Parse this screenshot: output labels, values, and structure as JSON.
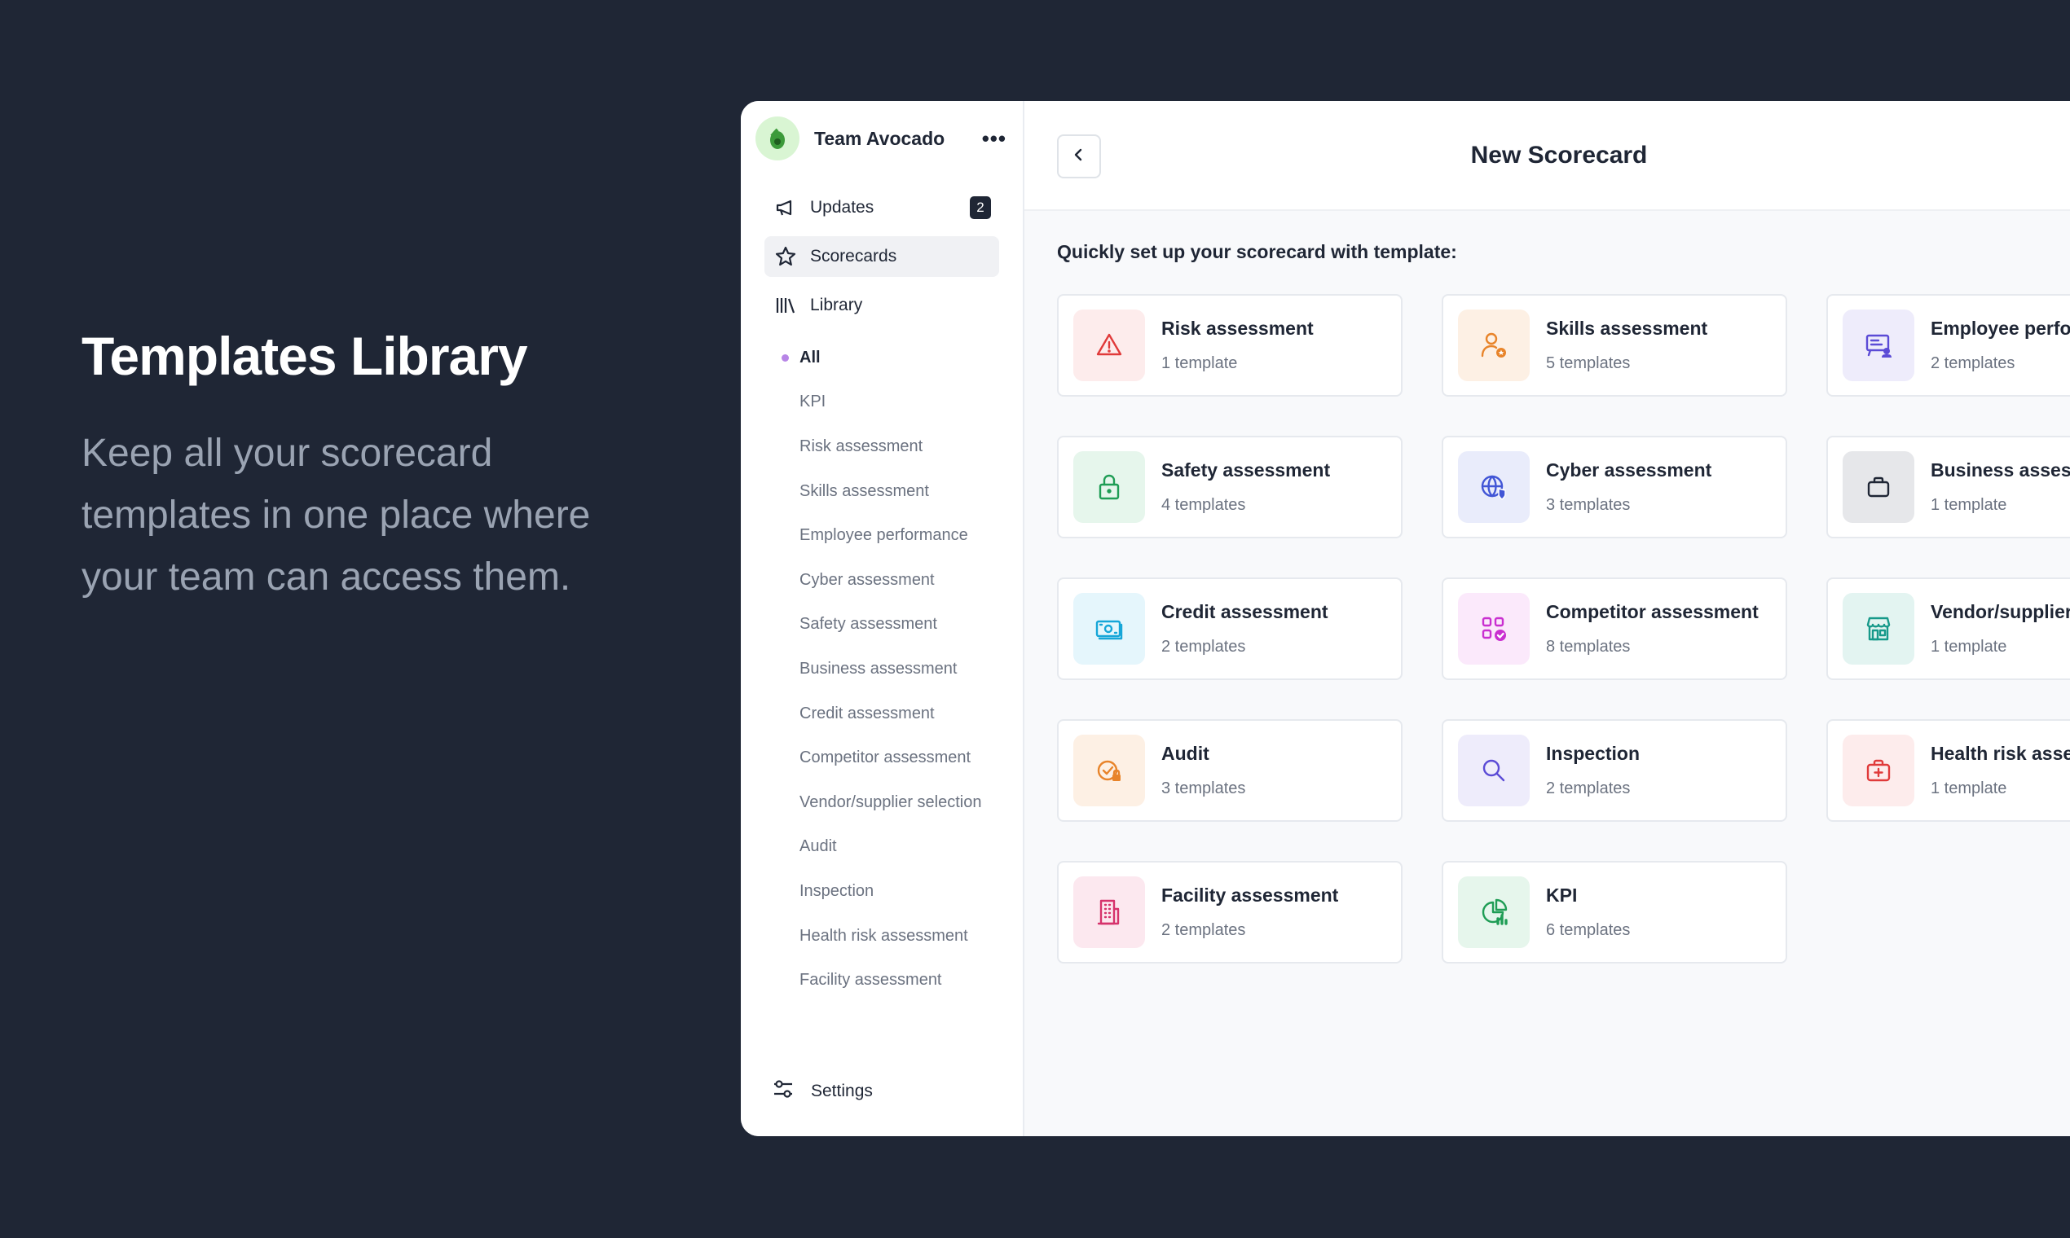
{
  "hero": {
    "title": "Templates Library",
    "description": "Keep all your scorecard templates in one place where your team can access them."
  },
  "sidebar": {
    "team_name": "Team Avocado",
    "more_label": "•••",
    "nav": [
      {
        "label": "Updates",
        "badge": "2"
      },
      {
        "label": "Scorecards"
      },
      {
        "label": "Library"
      }
    ],
    "categories": [
      "All",
      "KPI",
      "Risk assessment",
      "Skills assessment",
      "Employee performance",
      "Cyber assessment",
      "Safety assessment",
      "Business assessment",
      "Credit assessment",
      "Competitor assessment",
      "Vendor/supplier selection",
      "Audit",
      "Inspection",
      "Health risk assessment",
      "Facility assessment"
    ],
    "settings_label": "Settings"
  },
  "main": {
    "title": "New Scorecard",
    "subtitle": "Quickly set up your scorecard with template:",
    "cards": [
      {
        "title": "Risk assessment",
        "count": "1 template",
        "icon": "warning-icon",
        "bg": "#fdecec",
        "color": "#e03a3a"
      },
      {
        "title": "Skills assessment",
        "count": "5 templates",
        "icon": "user-star-icon",
        "bg": "#fdf0e4",
        "color": "#e8842a"
      },
      {
        "title": "Employee performance",
        "count": "2 templates",
        "icon": "presentation-icon",
        "bg": "#eeecfb",
        "color": "#5b4bd6"
      },
      {
        "title": "Safety assessment",
        "count": "4 templates",
        "icon": "lock-icon",
        "bg": "#e6f6ec",
        "color": "#1f9d55"
      },
      {
        "title": "Cyber assessment",
        "count": "3 templates",
        "icon": "globe-shield-icon",
        "bg": "#e9ecfb",
        "color": "#4256d6"
      },
      {
        "title": "Business assessment",
        "count": "1 template",
        "icon": "briefcase-icon",
        "bg": "#e6e7ea",
        "color": "#1f2635"
      },
      {
        "title": "Credit assessment",
        "count": "2 templates",
        "icon": "money-icon",
        "bg": "#e5f6fc",
        "color": "#16a6d8"
      },
      {
        "title": "Competitor assessment",
        "count": "8 templates",
        "icon": "competitor-icon",
        "bg": "#fbe9fb",
        "color": "#c92fd0"
      },
      {
        "title": "Vendor/supplier selection",
        "count": "1 template",
        "icon": "store-icon",
        "bg": "#e3f4f1",
        "color": "#17998a"
      },
      {
        "title": "Audit",
        "count": "3 templates",
        "icon": "audit-icon",
        "bg": "#fdf0e4",
        "color": "#e8842a"
      },
      {
        "title": "Inspection",
        "count": "2 templates",
        "icon": "search-icon",
        "bg": "#eeecfb",
        "color": "#5b4bd6"
      },
      {
        "title": "Health risk assessment",
        "count": "1 template",
        "icon": "medical-bag-icon",
        "bg": "#fdecec",
        "color": "#e03a3a"
      },
      {
        "title": "Facility assessment",
        "count": "2 templates",
        "icon": "building-icon",
        "bg": "#fce8ef",
        "color": "#d6336c"
      },
      {
        "title": "KPI",
        "count": "6 templates",
        "icon": "chart-icon",
        "bg": "#e6f6ec",
        "color": "#1f9d55"
      }
    ]
  }
}
